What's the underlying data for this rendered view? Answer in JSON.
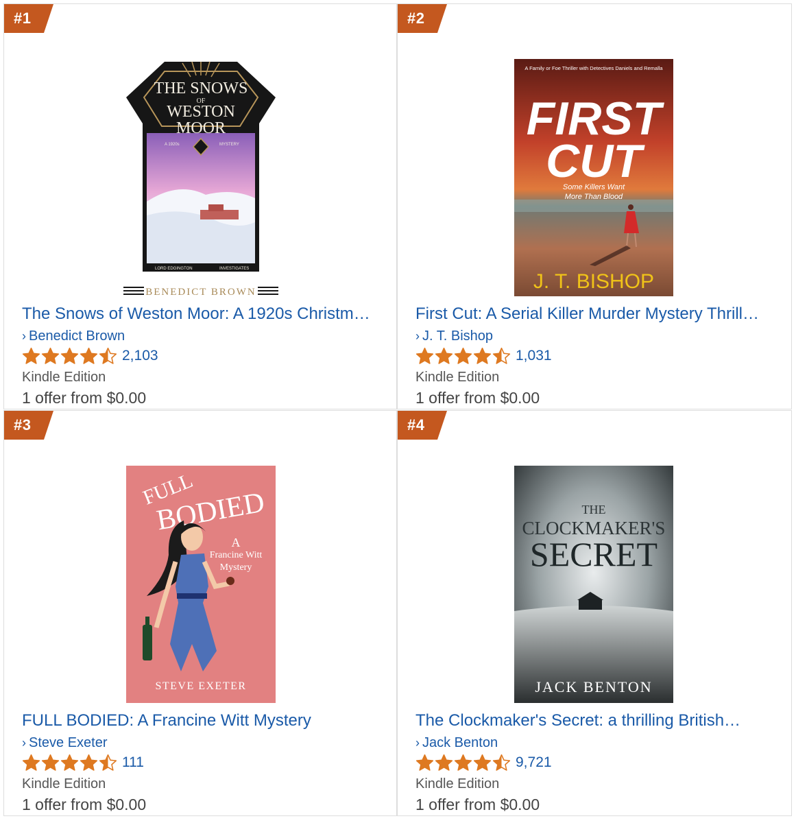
{
  "accent_badge_color": "#c4581f",
  "star_color": "#de7921",
  "link_color": "#1a5aa8",
  "items": [
    {
      "rank": "#1",
      "title": "The Snows of Weston Moor: A 1920s Christm…",
      "author": "Benedict Brown",
      "rating": 4.5,
      "reviews": "2,103",
      "format": "Kindle Edition",
      "offer": "1 offer from $0.00",
      "cover": {
        "line1": "THE SNOWS",
        "line2": "OF",
        "line3": "WESTON",
        "line4": "MOOR",
        "author": "BENEDICT BROWN",
        "series_left": "LORD EDGINGTON",
        "series_right": "INVESTIGATES",
        "tag_left": "A 1920s",
        "tag_right": "MYSTERY"
      }
    },
    {
      "rank": "#2",
      "title": "First Cut: A Serial Killer Murder Mystery Thrill…",
      "author": "J. T. Bishop",
      "rating": 4.5,
      "reviews": "1,031",
      "format": "Kindle Edition",
      "offer": "1 offer from $0.00",
      "cover": {
        "tagline": "A Family or Foe Thriller with Detectives Daniels and Remalla",
        "line1": "FIRST",
        "line2": "CUT",
        "sub1": "Some Killers Want",
        "sub2": "More Than Blood",
        "author": "J. T. BISHOP"
      }
    },
    {
      "rank": "#3",
      "title": "FULL BODIED: A Francine Witt Mystery",
      "author": "Steve Exeter",
      "rating": 4.5,
      "reviews": "111",
      "format": "Kindle Edition",
      "offer": "1 offer from $0.00",
      "cover": {
        "line1": "FULL",
        "line2": "BODIED",
        "sub1": "A",
        "sub2": "Francine Witt",
        "sub3": "Mystery",
        "author": "STEVE EXETER"
      }
    },
    {
      "rank": "#4",
      "title": "The Clockmaker's Secret: a thrilling British…",
      "author": "Jack Benton",
      "rating": 4.5,
      "reviews": "9,721",
      "format": "Kindle Edition",
      "offer": "1 offer from $0.00",
      "cover": {
        "line1": "THE",
        "line2": "CLOCKMAKER'S",
        "line3": "SECRET",
        "author": "JACK BENTON"
      }
    }
  ]
}
